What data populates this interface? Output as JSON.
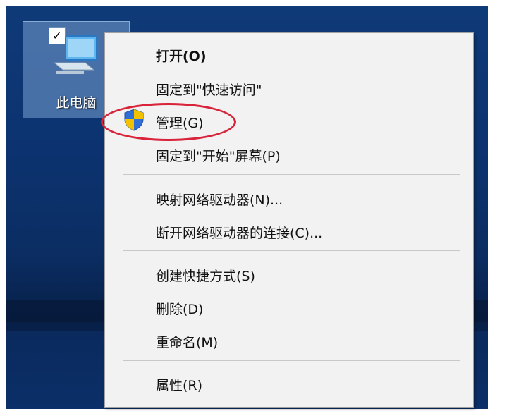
{
  "desktop": {
    "icon_label": "此电脑",
    "checkbox_mark": "✓"
  },
  "context_menu": {
    "items": [
      {
        "label": "打开(O)",
        "bold": true
      },
      {
        "label": "固定到\"快速访问\""
      },
      {
        "label": "管理(G)",
        "icon": "shield-icon",
        "highlighted": true
      },
      {
        "label": "固定到\"开始\"屏幕(P)"
      },
      {
        "label": "映射网络驱动器(N)..."
      },
      {
        "label": "断开网络驱动器的连接(C)..."
      },
      {
        "label": "创建快捷方式(S)"
      },
      {
        "label": "删除(D)"
      },
      {
        "label": "重命名(M)"
      },
      {
        "label": "属性(R)"
      }
    ],
    "highlight_color": "#d8233a",
    "shield_colors": [
      "#f2c200",
      "#2f6fd6"
    ]
  }
}
